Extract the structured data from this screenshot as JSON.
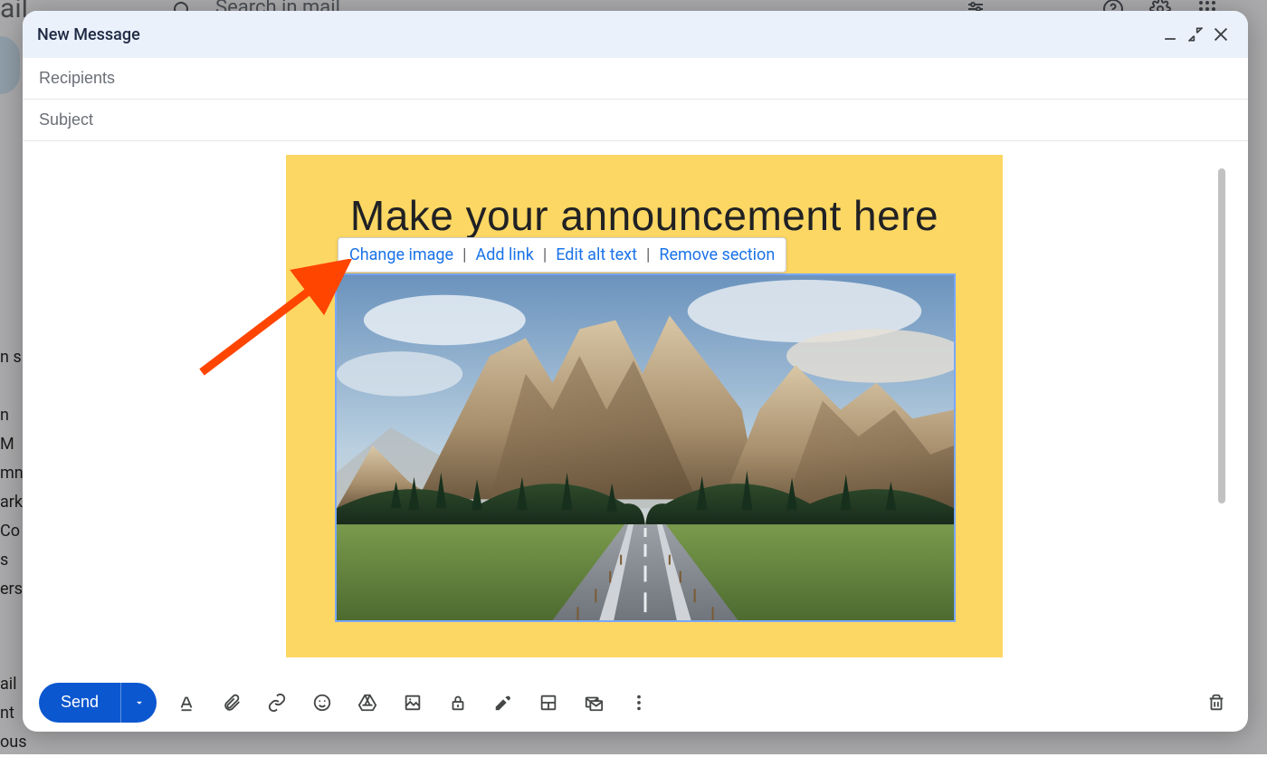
{
  "background": {
    "product_fragment": "ail",
    "search_placeholder": "Search in mail",
    "left_list_top": [
      "n s",
      "",
      "n M",
      "mn",
      "ark",
      "Co",
      "s",
      "ers"
    ],
    "left_list_bottom": [
      "ail",
      "nt",
      "ous"
    ]
  },
  "compose": {
    "title": "New Message",
    "recipients_placeholder": "Recipients",
    "subject_placeholder": "Subject",
    "template": {
      "heading": "Make your announcement here"
    },
    "image_toolbar": {
      "change_image": "Change image",
      "add_link": "Add link",
      "edit_alt_text": "Edit alt text",
      "remove_section": "Remove section",
      "separator": "|"
    },
    "send_label": "Send"
  },
  "icons": {
    "minimize": "minimize",
    "exit_fullscreen": "exit-fullscreen",
    "close": "close",
    "text_format": "text-format",
    "attach": "attach",
    "link": "link",
    "emoji": "emoji",
    "drive": "drive",
    "image": "image",
    "confidential": "confidential",
    "signature": "signature",
    "layout": "layout",
    "mail_template": "mail-template",
    "more": "more",
    "delete": "delete",
    "chevron_down": "chevron-down",
    "search": "search",
    "tune": "tune",
    "help": "help",
    "settings": "settings",
    "apps": "apps"
  }
}
